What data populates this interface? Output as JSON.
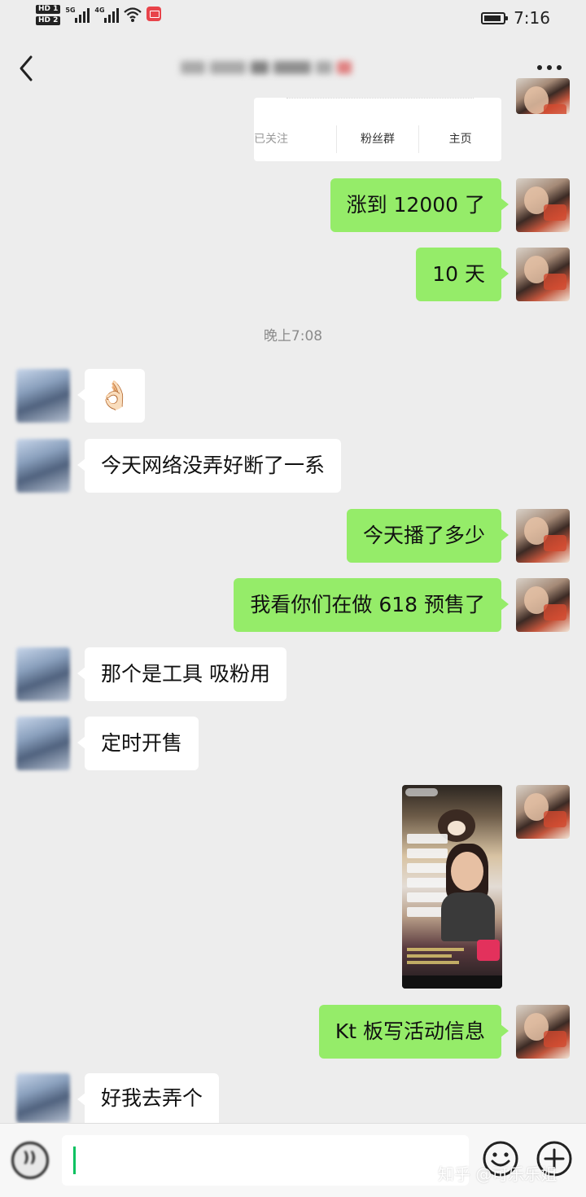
{
  "status_bar": {
    "hd1": "HD 1",
    "hd2": "HD 2",
    "net1": "5G",
    "net2": "4G",
    "time": "7:16"
  },
  "nav": {
    "title": "",
    "more_icon": "more-dots-icon",
    "back_icon": "chevron-left-icon"
  },
  "shared_card": {
    "actions": [
      "已关注",
      "粉丝群",
      "主页"
    ]
  },
  "messages": [
    {
      "from": "me",
      "text": "涨到 12000 了"
    },
    {
      "from": "me",
      "text": "10 天"
    },
    {
      "type": "time",
      "text": "晚上7:08"
    },
    {
      "from": "them",
      "type": "emoji",
      "text": "👌🏻"
    },
    {
      "from": "them",
      "text": "今天网络没弄好断了一系"
    },
    {
      "from": "me",
      "text": "今天播了多少"
    },
    {
      "from": "me",
      "text": "我看你们在做 618 预售了"
    },
    {
      "from": "them",
      "text": "那个是工具 吸粉用"
    },
    {
      "from": "them",
      "text": "定时开售"
    },
    {
      "from": "me",
      "type": "image",
      "text": ""
    },
    {
      "from": "me",
      "text": "Kt 板写活动信息"
    },
    {
      "from": "them",
      "text": "好我去弄个"
    }
  ],
  "input_bar": {
    "voice_icon": "voice-icon",
    "emoji_icon": "emoji-smile-icon",
    "plus_icon": "plus-circle-icon",
    "value": ""
  },
  "watermark": "知乎 @可乐乐姐",
  "colors": {
    "background": "#ededed",
    "my_bubble": "#95ec69",
    "their_bubble": "#ffffff",
    "caret": "#07c160"
  }
}
